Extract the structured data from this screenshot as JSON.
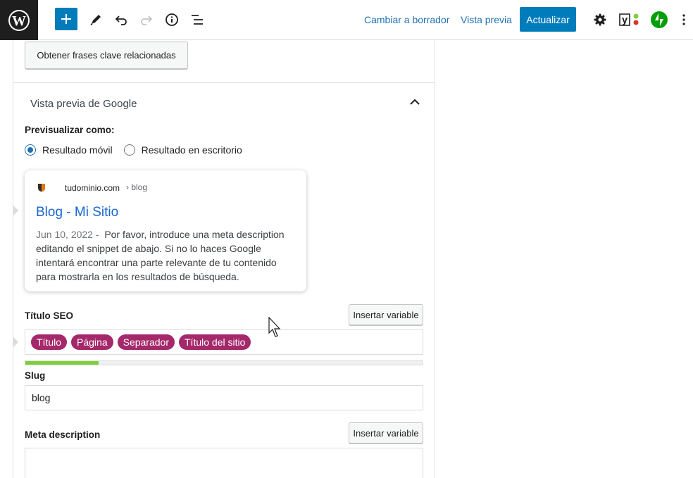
{
  "toolbar": {
    "cambiar_borrador": "Cambiar a borrador",
    "vista_previa": "Vista previa",
    "actualizar": "Actualizar"
  },
  "panel": {
    "related_keyphrases_button": "Obtener frases clave relacionadas",
    "google_preview_title": "Vista previa de Google",
    "preview_as_label": "Previsualizar como:",
    "radio_mobile": "Resultado móvil",
    "radio_desktop": "Resultado en escritorio",
    "selected_preview": "mobile"
  },
  "google_card": {
    "domain": "tudominio.com",
    "breadcrumb": "› blog",
    "title": "Blog - Mi Sitio",
    "date": "Jun 10, 2022",
    "separator": " - ",
    "description": "Por favor, introduce una meta description editando el snippet de abajo. Si no lo haces Google intentará encontrar una parte relevante de tu contenido para mostrarla en los resultados de búsqueda."
  },
  "seo_title": {
    "label": "Título SEO",
    "insert_variable": "Insertar variable",
    "chips": [
      "Título",
      "Página",
      "Separador",
      "Título del sitio"
    ],
    "progress": 0.185
  },
  "slug": {
    "label": "Slug",
    "value": "blog"
  },
  "meta_description": {
    "label": "Meta description",
    "insert_variable": "Insertar variable",
    "value": ""
  },
  "colors": {
    "primary": "#007cba",
    "chip": "#a4286a",
    "progress_good": "#7ad03a",
    "google_link": "#1967d2",
    "jetpack": "#069e08"
  }
}
